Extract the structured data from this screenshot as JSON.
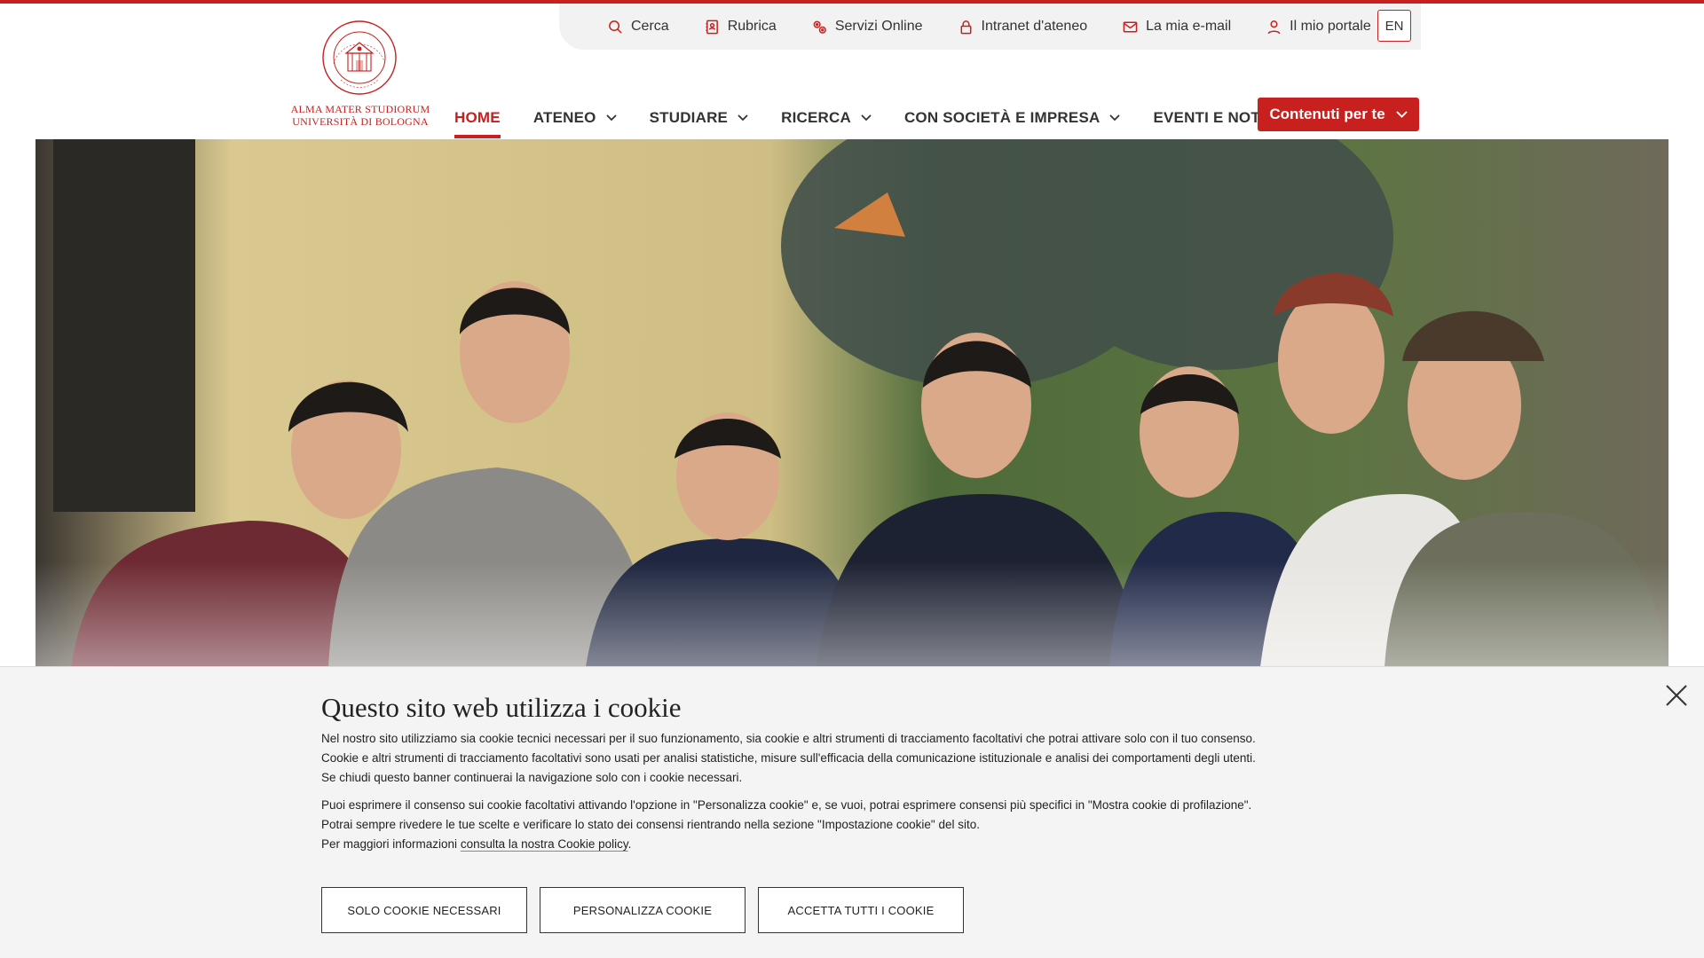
{
  "colors": {
    "brand_red": "#c8201f",
    "banner_bg": "#f4f4f4"
  },
  "utility": {
    "items": [
      {
        "label": "Cerca",
        "icon": "search-icon"
      },
      {
        "label": "Rubrica",
        "icon": "address-book-icon"
      },
      {
        "label": "Servizi Online",
        "icon": "online-services-icon"
      },
      {
        "label": "Intranet d'ateneo",
        "icon": "lock-icon"
      },
      {
        "label": "La mia e-mail",
        "icon": "mail-icon"
      },
      {
        "label": "Il mio portale",
        "icon": "user-icon"
      }
    ],
    "lang": "EN"
  },
  "logo": {
    "seal_text": "ALMA MATER STUDIORUM · A.D. 1088",
    "line1": "ALMA MATER STUDIORUM",
    "line2": "UNIVERSITÀ DI BOLOGNA"
  },
  "nav": {
    "items": [
      {
        "label": "HOME",
        "active": true,
        "dropdown": false
      },
      {
        "label": "ATENEO",
        "active": false,
        "dropdown": true
      },
      {
        "label": "STUDIARE",
        "active": false,
        "dropdown": true
      },
      {
        "label": "RICERCA",
        "active": false,
        "dropdown": true
      },
      {
        "label": "CON SOCIETÀ E IMPRESA",
        "active": false,
        "dropdown": true
      },
      {
        "label": "EVENTI E NOTIZIE",
        "active": false,
        "dropdown": false
      }
    ],
    "cta": "Contenuti per te"
  },
  "hero": {
    "image": "group-of-students-photo"
  },
  "cookie": {
    "title": "Questo sito web utilizza i cookie",
    "p1": [
      "Nel nostro sito utilizziamo sia cookie tecnici necessari per il suo funzionamento, sia cookie e altri strumenti di tracciamento facoltativi che potrai attivare solo con il tuo consenso.",
      "Cookie e altri strumenti di tracciamento facoltativi sono usati per analisi statistiche, misure sull'efficacia della comunicazione istituzionale e analisi dei comportamenti degli utenti.",
      "Se chiudi questo banner continuerai la navigazione solo con i cookie necessari."
    ],
    "p2": [
      "Puoi esprimere il consenso sui cookie facoltativi attivando l'opzione in \"Personalizza cookie\" e, se vuoi, potrai esprimere consensi più specifici in \"Mostra cookie di profilazione\".",
      "Potrai sempre rivedere le tue scelte e verificare lo stato dei consensi rientrando nella sezione \"Impostazione cookie\" del sito."
    ],
    "p3_prefix": "Per maggiori informazioni ",
    "p3_link": "consulta la nostra Cookie policy",
    "p3_suffix": ".",
    "buttons": {
      "necessary": "SOLO COOKIE NECESSARI",
      "customize": "PERSONALIZZA COOKIE",
      "accept_all": "ACCETTA TUTTI I COOKIE"
    }
  }
}
